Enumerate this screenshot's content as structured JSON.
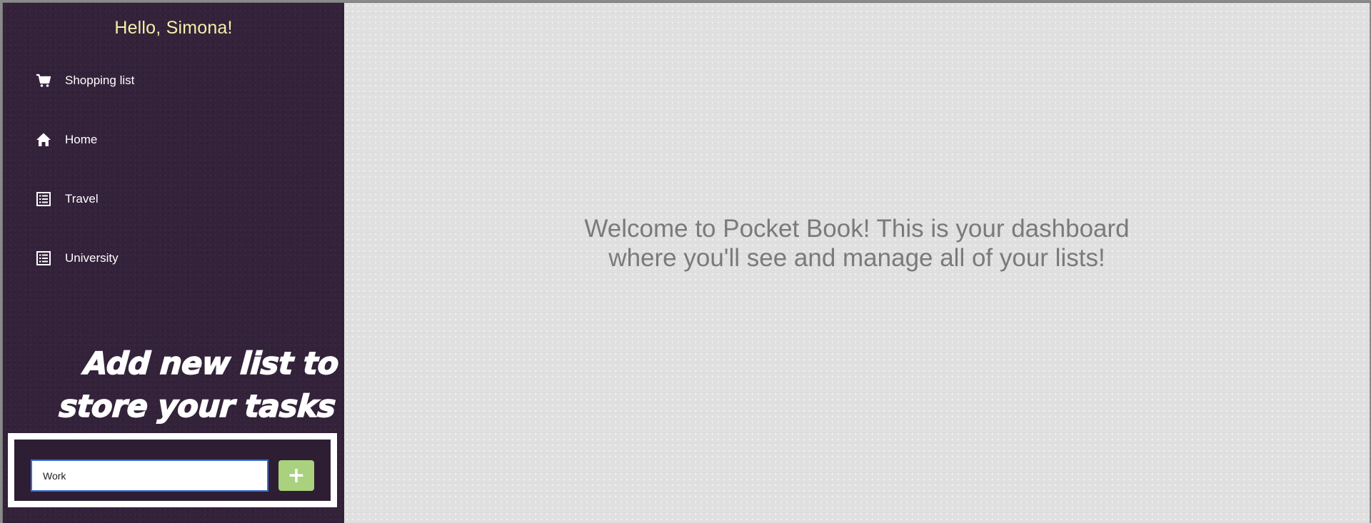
{
  "sidebar": {
    "greeting": "Hello, Simona!",
    "items": [
      {
        "label": "Shopping list",
        "icon": "cart-icon"
      },
      {
        "label": "Home",
        "icon": "home-icon"
      },
      {
        "label": "Travel",
        "icon": "list-icon"
      },
      {
        "label": "University",
        "icon": "list-icon"
      }
    ],
    "promo_line1": "Add new list to",
    "promo_line2": "store your tasks",
    "new_list": {
      "value": "Work",
      "button_label": "+"
    }
  },
  "main": {
    "welcome_line1": "Welcome to Pocket Book! This is your dashboard",
    "welcome_line2": "where you'll see and manage all of your lists!"
  },
  "colors": {
    "sidebar_bg": "#33223a",
    "greeting": "#f6f0a8",
    "add_button": "#a9d17e",
    "main_bg": "#e0e0e0",
    "welcome_text": "#7a7a7a",
    "input_border": "#3b6fd4"
  }
}
